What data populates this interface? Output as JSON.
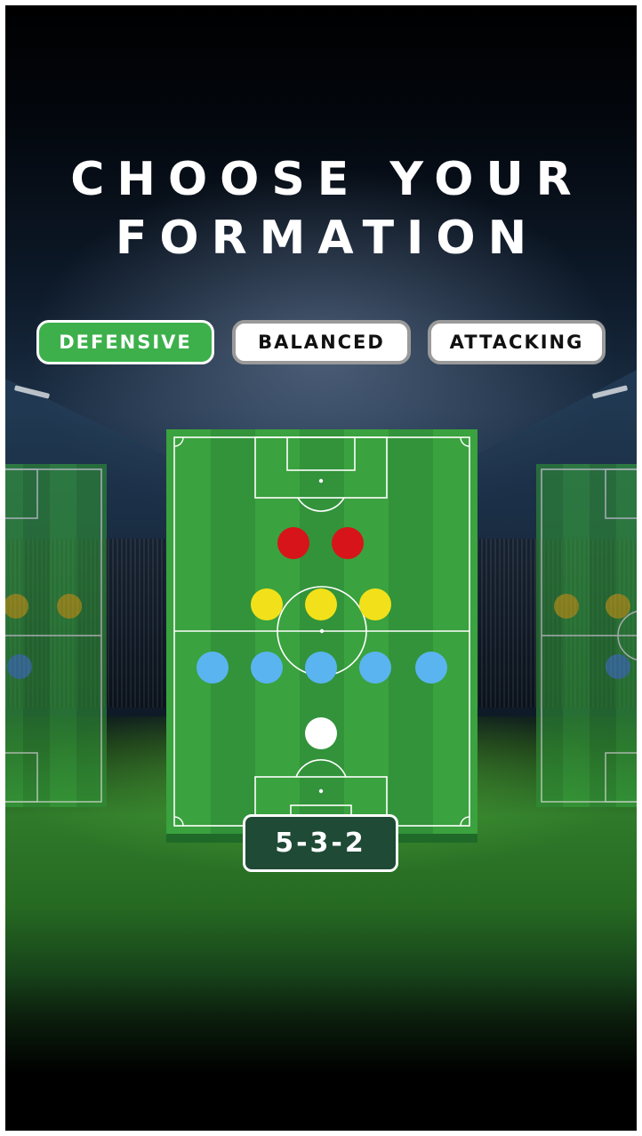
{
  "title": {
    "line1": "CHOOSE YOUR",
    "line2": "FORMATION"
  },
  "tabs": [
    {
      "id": "defensive",
      "label": "DEFENSIVE",
      "selected": true
    },
    {
      "id": "balanced",
      "label": "BALANCED",
      "selected": false
    },
    {
      "id": "attacking",
      "label": "ATTACKING",
      "selected": false
    }
  ],
  "formation": {
    "label": "5-3-2"
  },
  "colors": {
    "selected_tab": "#3db04b",
    "badge": "#1f4a36",
    "pitch_light": "#3aa23e",
    "pitch_dark": "#32933a",
    "forward": "#d7141a",
    "midfielder": "#f2e11a",
    "defender": "#5ab4f0",
    "goalkeeper": "#ffffff"
  },
  "players": [
    {
      "role": "forward",
      "color": "#d7141a"
    },
    {
      "role": "forward",
      "color": "#d7141a"
    },
    {
      "role": "midfielder",
      "color": "#f2e11a"
    },
    {
      "role": "midfielder",
      "color": "#f2e11a"
    },
    {
      "role": "midfielder",
      "color": "#f2e11a"
    },
    {
      "role": "defender",
      "color": "#5ab4f0"
    },
    {
      "role": "defender",
      "color": "#5ab4f0"
    },
    {
      "role": "defender",
      "color": "#5ab4f0"
    },
    {
      "role": "defender",
      "color": "#5ab4f0"
    },
    {
      "role": "defender",
      "color": "#5ab4f0"
    },
    {
      "role": "goalkeeper",
      "color": "#ffffff"
    }
  ]
}
